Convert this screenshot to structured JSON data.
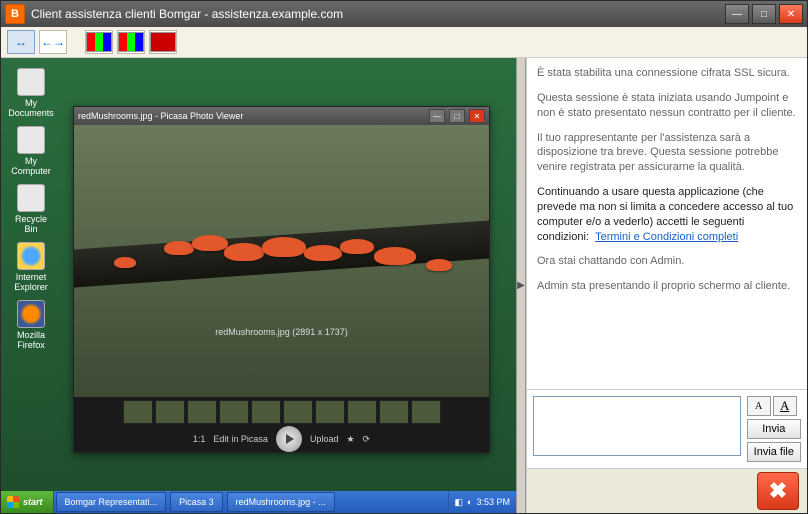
{
  "window": {
    "app_icon_letter": "B",
    "title": "Client assistenza clienti Bomgar - assistenza.example.com"
  },
  "desktop_icons": [
    {
      "label": "My Documents"
    },
    {
      "label": "My Computer"
    },
    {
      "label": "Recycle Bin"
    },
    {
      "label": "Internet Explorer"
    },
    {
      "label": "Mozilla Firefox"
    }
  ],
  "viewer": {
    "title": "redMushrooms.jpg - Picasa Photo Viewer",
    "caption": "redMushrooms.jpg (2891 x 1737)",
    "edit_label": "Edit in Picasa",
    "upload_label": "Upload",
    "ratio_label": "1:1"
  },
  "taskbar": {
    "start": "start",
    "tasks": [
      "Bomgar Representati...",
      "Picasa 3",
      "redMushrooms.jpg - ..."
    ],
    "clock": "3:53 PM"
  },
  "chat": {
    "messages": [
      {
        "cls": "",
        "text": "È stata stabilita una connessione cifrata SSL sicura."
      },
      {
        "cls": "",
        "text": "Questa sessione è stata iniziata usando Jumpoint e non è stato presentato nessun contratto per il cliente."
      },
      {
        "cls": "",
        "text": "Il tuo rappresentante per l'assistenza sarà a disposizione tra breve. Questa sessione potrebbe venire registrata per assicurarne la qualità."
      },
      {
        "cls": "strong",
        "text": "Continuando a usare questa applicazione (che prevede ma non si limita a concedere accesso al tuo computer e/o a vederlo) accetti le seguenti condizioni:"
      },
      {
        "cls": "",
        "text": "Ora stai chattando con Admin."
      },
      {
        "cls": "",
        "text": "Admin sta presentando il proprio schermo al cliente."
      }
    ],
    "terms_link": "Termini e Condizioni completi",
    "font_small": "A",
    "font_large": "A",
    "send": "Invia",
    "send_file": "Invia file"
  }
}
